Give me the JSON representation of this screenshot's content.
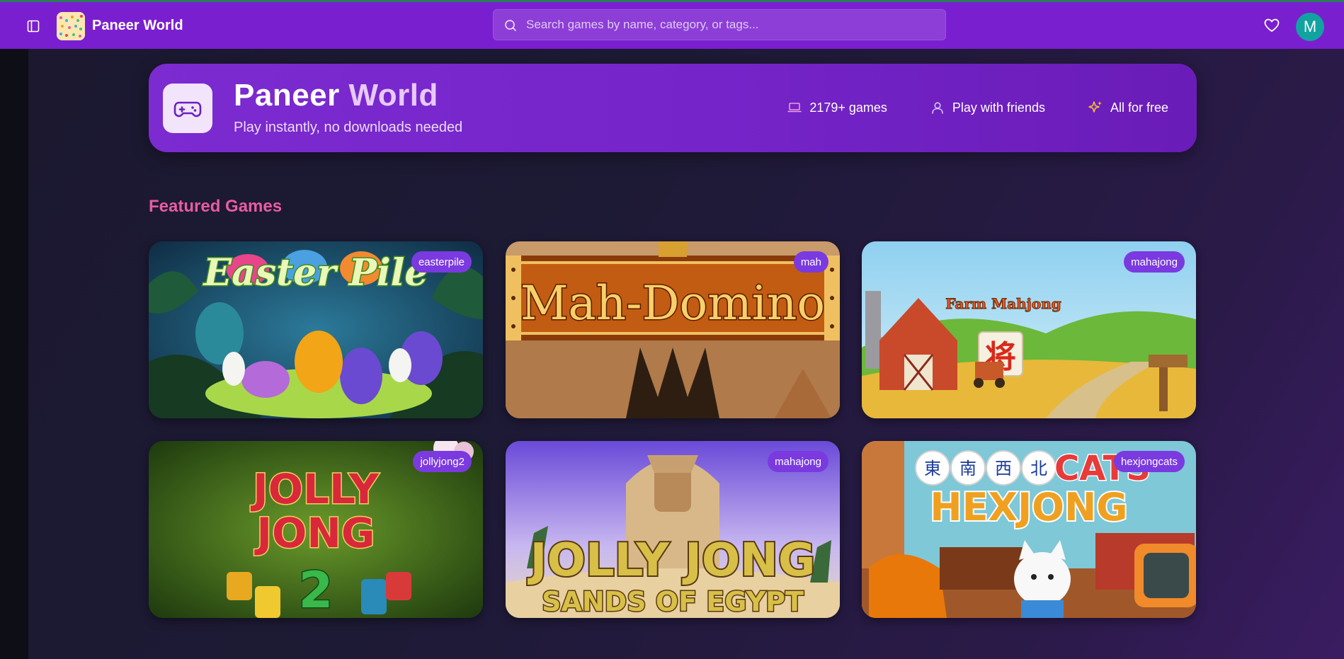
{
  "header": {
    "brand_name": "Paneer World",
    "search_placeholder": "Search games by name, category, or tags...",
    "avatar_initial": "M",
    "accent_color": "#7a1fd0"
  },
  "hero": {
    "title_part1": "Paneer",
    "title_part2": "World",
    "subtitle": "Play instantly, no downloads needed",
    "stats": [
      {
        "icon": "laptop-icon",
        "label": "2179+ games"
      },
      {
        "icon": "user-icon",
        "label": "Play with friends"
      },
      {
        "icon": "sparkles-icon",
        "label": "All for free"
      }
    ]
  },
  "featured": {
    "title": "Featured Games",
    "games": [
      {
        "tag": "easterpile",
        "art_text": "Easter Pile"
      },
      {
        "tag": "mah",
        "art_text": "Mah-Domino"
      },
      {
        "tag": "mahajong",
        "art_text": "Farm Mahjong",
        "art_text_badge": "将"
      },
      {
        "tag": "jollyjong2",
        "art_text": [
          "JOLLY",
          "JONG",
          "2"
        ]
      },
      {
        "tag": "mahajong",
        "art_text": [
          "JOLLY JONG",
          "SANDS OF EGYPT"
        ]
      },
      {
        "tag": "hexjongcats",
        "art_text": [
          "CATS",
          "HEXJONG"
        ],
        "art_tiles": [
          "東",
          "南",
          "西",
          "北"
        ]
      }
    ]
  }
}
